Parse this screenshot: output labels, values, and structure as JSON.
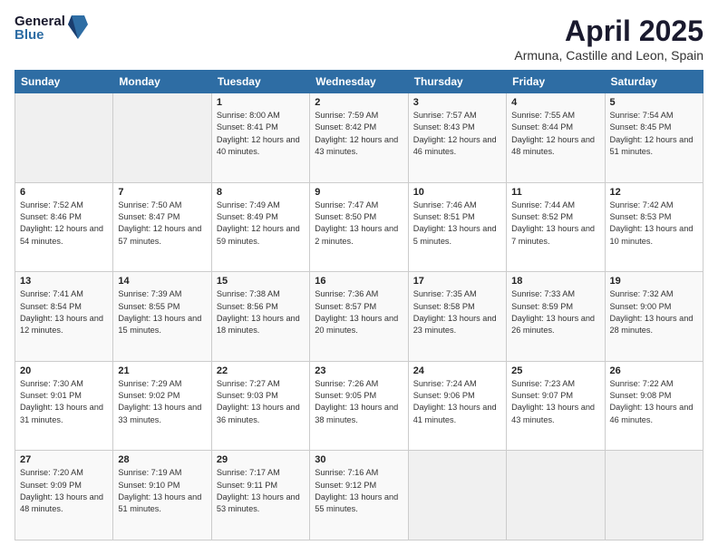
{
  "logo": {
    "general": "General",
    "blue": "Blue"
  },
  "title": "April 2025",
  "subtitle": "Armuna, Castille and Leon, Spain",
  "days_of_week": [
    "Sunday",
    "Monday",
    "Tuesday",
    "Wednesday",
    "Thursday",
    "Friday",
    "Saturday"
  ],
  "weeks": [
    [
      null,
      null,
      {
        "day": 1,
        "sunrise": "8:00 AM",
        "sunset": "8:41 PM",
        "daylight": "12 hours and 40 minutes."
      },
      {
        "day": 2,
        "sunrise": "7:59 AM",
        "sunset": "8:42 PM",
        "daylight": "12 hours and 43 minutes."
      },
      {
        "day": 3,
        "sunrise": "7:57 AM",
        "sunset": "8:43 PM",
        "daylight": "12 hours and 46 minutes."
      },
      {
        "day": 4,
        "sunrise": "7:55 AM",
        "sunset": "8:44 PM",
        "daylight": "12 hours and 48 minutes."
      },
      {
        "day": 5,
        "sunrise": "7:54 AM",
        "sunset": "8:45 PM",
        "daylight": "12 hours and 51 minutes."
      }
    ],
    [
      {
        "day": 6,
        "sunrise": "7:52 AM",
        "sunset": "8:46 PM",
        "daylight": "12 hours and 54 minutes."
      },
      {
        "day": 7,
        "sunrise": "7:50 AM",
        "sunset": "8:47 PM",
        "daylight": "12 hours and 57 minutes."
      },
      {
        "day": 8,
        "sunrise": "7:49 AM",
        "sunset": "8:49 PM",
        "daylight": "12 hours and 59 minutes."
      },
      {
        "day": 9,
        "sunrise": "7:47 AM",
        "sunset": "8:50 PM",
        "daylight": "13 hours and 2 minutes."
      },
      {
        "day": 10,
        "sunrise": "7:46 AM",
        "sunset": "8:51 PM",
        "daylight": "13 hours and 5 minutes."
      },
      {
        "day": 11,
        "sunrise": "7:44 AM",
        "sunset": "8:52 PM",
        "daylight": "13 hours and 7 minutes."
      },
      {
        "day": 12,
        "sunrise": "7:42 AM",
        "sunset": "8:53 PM",
        "daylight": "13 hours and 10 minutes."
      }
    ],
    [
      {
        "day": 13,
        "sunrise": "7:41 AM",
        "sunset": "8:54 PM",
        "daylight": "13 hours and 12 minutes."
      },
      {
        "day": 14,
        "sunrise": "7:39 AM",
        "sunset": "8:55 PM",
        "daylight": "13 hours and 15 minutes."
      },
      {
        "day": 15,
        "sunrise": "7:38 AM",
        "sunset": "8:56 PM",
        "daylight": "13 hours and 18 minutes."
      },
      {
        "day": 16,
        "sunrise": "7:36 AM",
        "sunset": "8:57 PM",
        "daylight": "13 hours and 20 minutes."
      },
      {
        "day": 17,
        "sunrise": "7:35 AM",
        "sunset": "8:58 PM",
        "daylight": "13 hours and 23 minutes."
      },
      {
        "day": 18,
        "sunrise": "7:33 AM",
        "sunset": "8:59 PM",
        "daylight": "13 hours and 26 minutes."
      },
      {
        "day": 19,
        "sunrise": "7:32 AM",
        "sunset": "9:00 PM",
        "daylight": "13 hours and 28 minutes."
      }
    ],
    [
      {
        "day": 20,
        "sunrise": "7:30 AM",
        "sunset": "9:01 PM",
        "daylight": "13 hours and 31 minutes."
      },
      {
        "day": 21,
        "sunrise": "7:29 AM",
        "sunset": "9:02 PM",
        "daylight": "13 hours and 33 minutes."
      },
      {
        "day": 22,
        "sunrise": "7:27 AM",
        "sunset": "9:03 PM",
        "daylight": "13 hours and 36 minutes."
      },
      {
        "day": 23,
        "sunrise": "7:26 AM",
        "sunset": "9:05 PM",
        "daylight": "13 hours and 38 minutes."
      },
      {
        "day": 24,
        "sunrise": "7:24 AM",
        "sunset": "9:06 PM",
        "daylight": "13 hours and 41 minutes."
      },
      {
        "day": 25,
        "sunrise": "7:23 AM",
        "sunset": "9:07 PM",
        "daylight": "13 hours and 43 minutes."
      },
      {
        "day": 26,
        "sunrise": "7:22 AM",
        "sunset": "9:08 PM",
        "daylight": "13 hours and 46 minutes."
      }
    ],
    [
      {
        "day": 27,
        "sunrise": "7:20 AM",
        "sunset": "9:09 PM",
        "daylight": "13 hours and 48 minutes."
      },
      {
        "day": 28,
        "sunrise": "7:19 AM",
        "sunset": "9:10 PM",
        "daylight": "13 hours and 51 minutes."
      },
      {
        "day": 29,
        "sunrise": "7:17 AM",
        "sunset": "9:11 PM",
        "daylight": "13 hours and 53 minutes."
      },
      {
        "day": 30,
        "sunrise": "7:16 AM",
        "sunset": "9:12 PM",
        "daylight": "13 hours and 55 minutes."
      },
      null,
      null,
      null
    ]
  ],
  "labels": {
    "sunrise": "Sunrise:",
    "sunset": "Sunset:",
    "daylight": "Daylight:"
  }
}
